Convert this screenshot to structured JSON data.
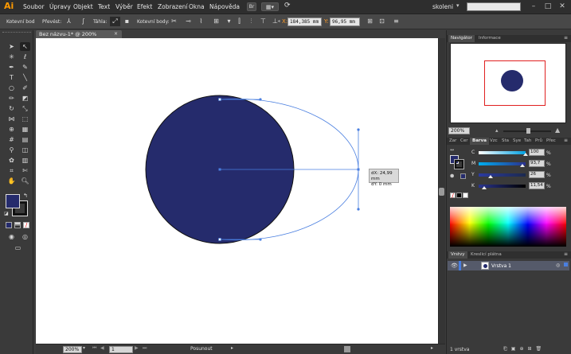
{
  "app": {
    "logo_text": "Ai",
    "menus": [
      "Soubor",
      "Úpravy",
      "Objekt",
      "Text",
      "Výběr",
      "Efekt",
      "Zobrazení",
      "Okna",
      "Nápověda"
    ],
    "user": "skoleni"
  },
  "control_bar": {
    "anchor_label": "Kotevní bod",
    "convert_label": "Převést:",
    "handles_label": "Táhla:",
    "anchors_label": "Kotevní body:",
    "x_label": "X:",
    "x_value": "184,385 mm",
    "y_label": "Y:",
    "y_value": "96,95 mm"
  },
  "document": {
    "tab_title": "Bez názvu-1* @ 200% (CMYK/Náhled)",
    "tab_close": "×",
    "zoom": "200%",
    "artboard": "1",
    "status_text": "Posunout"
  },
  "shape": {
    "fill_color": "#252b6c",
    "path_color": "#4a7fe0"
  },
  "tooltip": {
    "dx": "dX: 24,99 mm",
    "dy": "dY: 0 mm"
  },
  "navigator": {
    "tabs": [
      "Navigátor",
      "Informace"
    ],
    "zoom": "200%"
  },
  "color_panel": {
    "tabs": [
      "Zar",
      "Cer",
      "Barva",
      "Vzc",
      "Sta",
      "Sye",
      "Tah",
      "Prů",
      "Přec"
    ],
    "channels": [
      {
        "label": "C",
        "value": "100",
        "fraction": 1.0,
        "gradient": "linear-gradient(to right,#ffffff,#00a0e0)"
      },
      {
        "label": "M",
        "value": "93,7",
        "fraction": 0.937,
        "gradient": "linear-gradient(to right,#00aeef,#2b2f8c)"
      },
      {
        "label": "Y",
        "value": "26",
        "fraction": 0.26,
        "gradient": "linear-gradient(to right,#2b3aa0,#1c2a4e)"
      },
      {
        "label": "K",
        "value": "11,54",
        "fraction": 0.1154,
        "gradient": "linear-gradient(to right,#2a3590,#000000)"
      }
    ],
    "unit": "%"
  },
  "layers": {
    "tabs": [
      "Vrstvy",
      "Kreslicí plátna"
    ],
    "layer_name": "Vrstva 1",
    "count_label": "1 vrstva"
  }
}
